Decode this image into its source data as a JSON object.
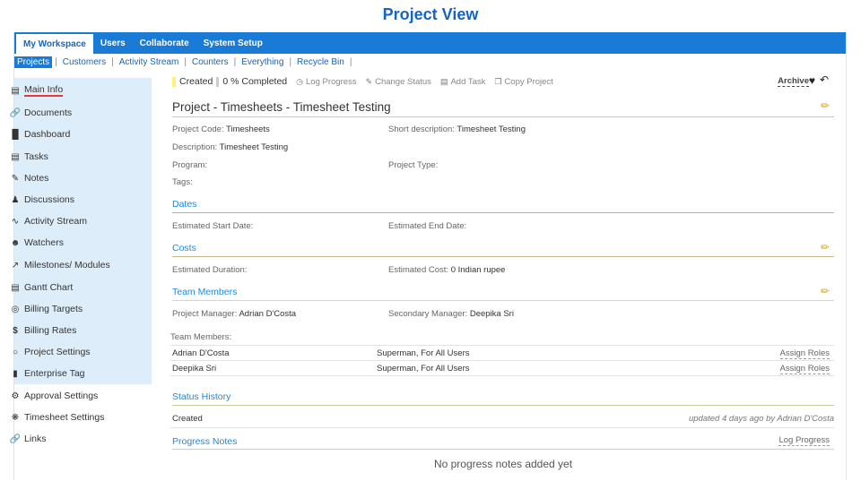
{
  "page": {
    "title": "Project View"
  },
  "topnav": {
    "tabs": [
      "My Workspace",
      "Users",
      "Collaborate",
      "System Setup"
    ]
  },
  "subnav": {
    "items": [
      "Projects",
      "Customers",
      "Activity Stream",
      "Counters",
      "Everything",
      "Recycle Bin"
    ]
  },
  "sidebar": {
    "items": [
      {
        "label": "Main Info",
        "icon": "info-icon"
      },
      {
        "label": "Documents",
        "icon": "link-icon"
      },
      {
        "label": "Dashboard",
        "icon": "bar-chart-icon"
      },
      {
        "label": "Tasks",
        "icon": "tasks-icon"
      },
      {
        "label": "Notes",
        "icon": "note-icon"
      },
      {
        "label": "Discussions",
        "icon": "discussion-icon"
      },
      {
        "label": "Activity Stream",
        "icon": "pulse-icon"
      },
      {
        "label": "Watchers",
        "icon": "watchers-icon"
      },
      {
        "label": "Milestones/ Modules",
        "icon": "milestone-icon"
      },
      {
        "label": "Gantt Chart",
        "icon": "gantt-icon"
      },
      {
        "label": "Billing Targets",
        "icon": "target-icon"
      },
      {
        "label": "Billing Rates",
        "icon": "dollar-icon"
      },
      {
        "label": "Project Settings",
        "icon": "circle-icon"
      },
      {
        "label": "Enterprise Tag",
        "icon": "bookmark-icon"
      },
      {
        "label": "Approval Settings",
        "icon": "gear-icon"
      },
      {
        "label": "Timesheet Settings",
        "icon": "cog-icon"
      },
      {
        "label": "Links",
        "icon": "link-icon"
      }
    ]
  },
  "toolbar": {
    "status": "Created",
    "progress": "0 % Completed",
    "actions": [
      "Log Progress",
      "Change Status",
      "Add Task",
      "Copy Project"
    ],
    "archive": "Archive"
  },
  "project": {
    "title": "Project - Timesheets - Timesheet Testing",
    "code_label": "Project Code:",
    "code": "Timesheets",
    "short_desc_label": "Short description:",
    "short_desc": "Timesheet Testing",
    "desc_label": "Description:",
    "desc": "Timesheet Testing",
    "program_label": "Program:",
    "type_label": "Project Type:",
    "tags_label": "Tags:"
  },
  "dates": {
    "heading": "Dates",
    "start_label": "Estimated Start Date:",
    "end_label": "Estimated End Date:"
  },
  "costs": {
    "heading": "Costs",
    "duration_label": "Estimated Duration:",
    "cost_label": "Estimated Cost:",
    "cost": "0 Indian rupee"
  },
  "team": {
    "heading": "Team Members",
    "pm_label": "Project Manager:",
    "pm": "Adrian D'Costa",
    "sm_label": "Secondary Manager:",
    "sm": "Deepika Sri",
    "members_label": "Team Members:",
    "members": [
      {
        "name": "Adrian D'Costa",
        "roles": "Superman, For All Users",
        "action": "Assign Roles"
      },
      {
        "name": "Deepika Sri",
        "roles": "Superman, For All Users",
        "action": "Assign Roles"
      }
    ]
  },
  "status_history": {
    "heading": "Status History",
    "status": "Created",
    "updated": "updated 4 days ago by Adrian D'Costa"
  },
  "progress_notes": {
    "heading": "Progress Notes",
    "action": "Log Progress",
    "empty": "No progress notes added yet"
  }
}
